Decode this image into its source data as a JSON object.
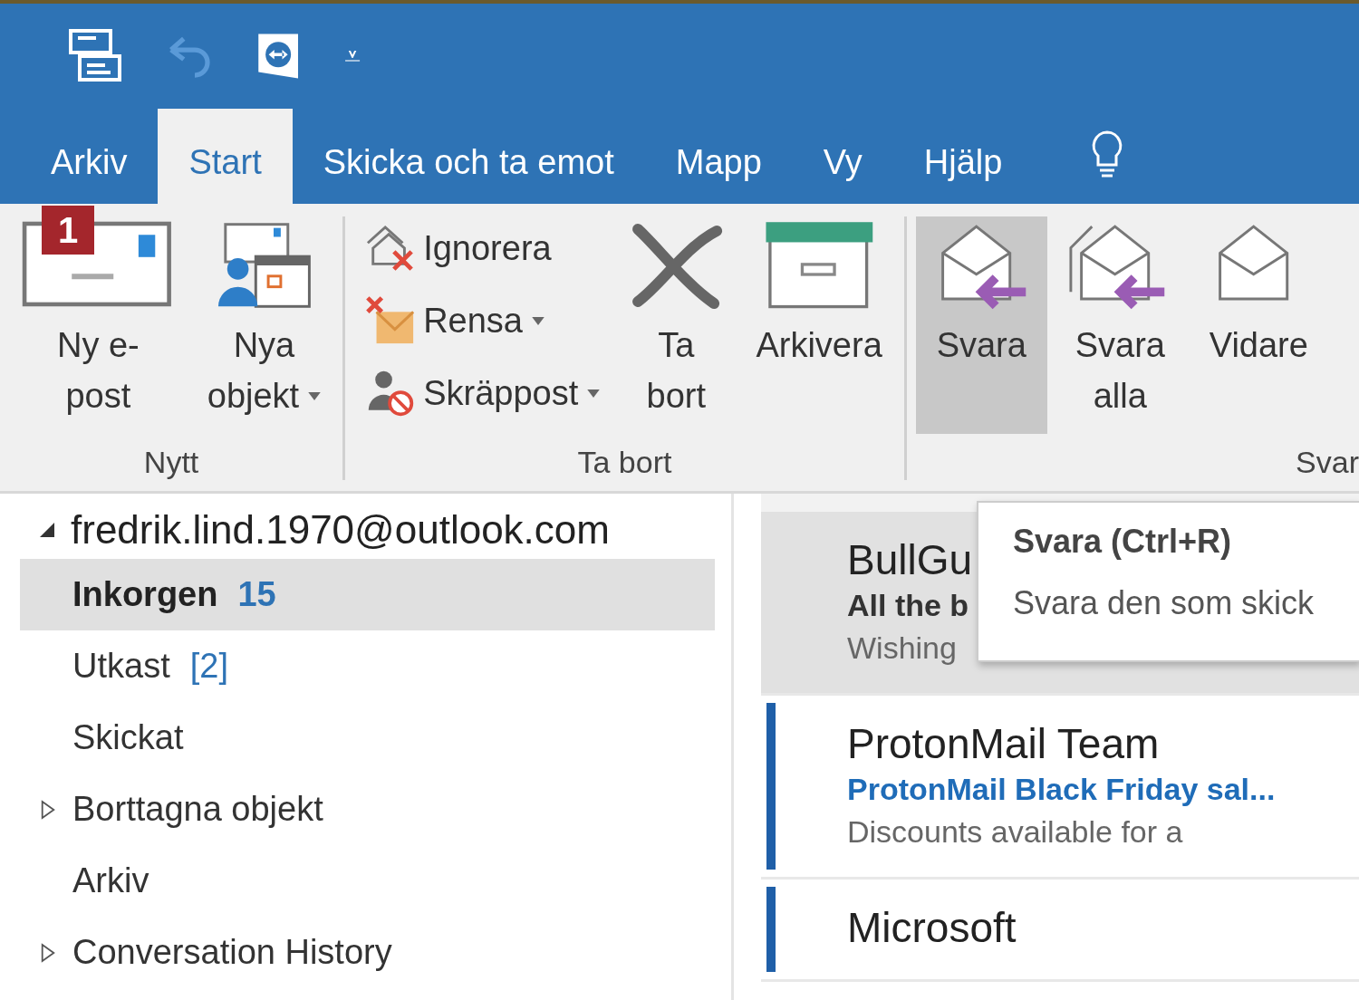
{
  "quick_access": {
    "more_button": "⩡"
  },
  "tabs": [
    {
      "label": "Arkiv",
      "selected": false
    },
    {
      "label": "Start",
      "selected": true
    },
    {
      "label": "Skicka och ta emot",
      "selected": false
    },
    {
      "label": "Mapp",
      "selected": false
    },
    {
      "label": "Vy",
      "selected": false
    },
    {
      "label": "Hjälp",
      "selected": false
    }
  ],
  "ribbon": {
    "groups": [
      {
        "label": "Nytt",
        "items": [
          {
            "kind": "large",
            "label": "Ny e-",
            "label2": "post",
            "dropdown": false,
            "selected": false,
            "keytip": "1"
          },
          {
            "kind": "large",
            "label": "Nya",
            "label2": "objekt",
            "dropdown": true,
            "selected": false
          }
        ]
      },
      {
        "label": "Ta bort",
        "items": [
          {
            "kind": "stack",
            "buttons": [
              {
                "label": "Ignorera",
                "dropdown": false
              },
              {
                "label": "Rensa",
                "dropdown": true
              },
              {
                "label": "Skräppost",
                "dropdown": true
              }
            ]
          },
          {
            "kind": "large",
            "label": "Ta",
            "label2": "bort",
            "dropdown": false,
            "selected": false
          },
          {
            "kind": "large",
            "label": "Arkivera",
            "dropdown": false,
            "selected": false
          }
        ]
      },
      {
        "label": "Svar",
        "items": [
          {
            "kind": "large",
            "label": "Svara",
            "dropdown": false,
            "selected": true
          },
          {
            "kind": "large",
            "label": "Svara",
            "label2": "alla",
            "dropdown": false,
            "selected": false
          },
          {
            "kind": "large",
            "label": "Vidare",
            "dropdown": false,
            "selected": false
          }
        ]
      }
    ]
  },
  "folders": {
    "account": "fredrik.lind.1970@outlook.com",
    "expanded": true,
    "items": [
      {
        "label": "Inkorgen",
        "count": "15",
        "unread": true,
        "selected": true,
        "has_subfolders": false
      },
      {
        "label": "Utkast",
        "count": "[2]",
        "unread": false,
        "selected": false,
        "has_subfolders": false
      },
      {
        "label": "Skickat",
        "unread": false,
        "selected": false,
        "has_subfolders": false
      },
      {
        "label": "Borttagna objekt",
        "unread": false,
        "selected": false,
        "has_subfolders": true
      },
      {
        "label": "Arkiv",
        "unread": false,
        "selected": false,
        "has_subfolders": false
      },
      {
        "label": "Conversation History",
        "unread": false,
        "selected": false,
        "has_subfolders": true
      }
    ]
  },
  "messages": [
    {
      "sender": "BullGu",
      "subject": "All the b",
      "preview": "Wishing",
      "selected": true,
      "unread": false
    },
    {
      "sender": "ProtonMail Team",
      "subject": "ProtonMail Black Friday sal...",
      "preview": "Discounts available for a",
      "selected": false,
      "unread": true
    },
    {
      "sender": "Microsoft",
      "selected": false,
      "unread": true
    }
  ],
  "tooltip": {
    "title": "Svara (Ctrl+R)",
    "text": "Svara den som skick"
  }
}
